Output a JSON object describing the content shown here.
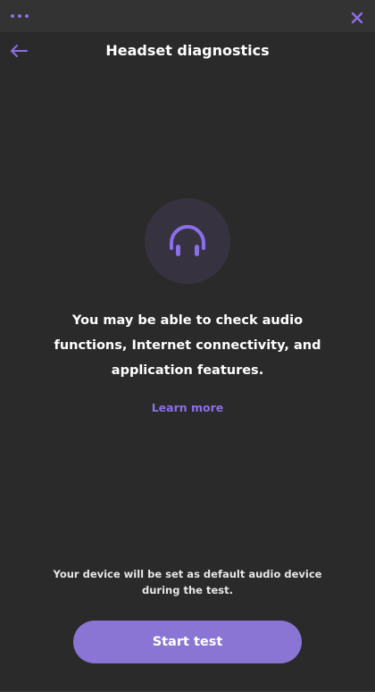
{
  "titlebar": {
    "menu_icon": "more-dots-icon",
    "close_icon": "close-icon"
  },
  "header": {
    "back_icon": "arrow-left-icon",
    "title": "Headset diagnostics"
  },
  "hero": {
    "icon": "headphones-icon"
  },
  "body": {
    "message": "You may be able to check audio functions, Internet connectivity, and application features.",
    "learn_more": "Learn more"
  },
  "footer": {
    "note": "Your device will be set as default audio device during the test.",
    "start_button": "Start test"
  },
  "colors": {
    "background": "#2a2a2a",
    "titlebar": "#333333",
    "accent": "#8a6fe8",
    "button": "#8a75d4",
    "hero_circle": "#37323f"
  }
}
